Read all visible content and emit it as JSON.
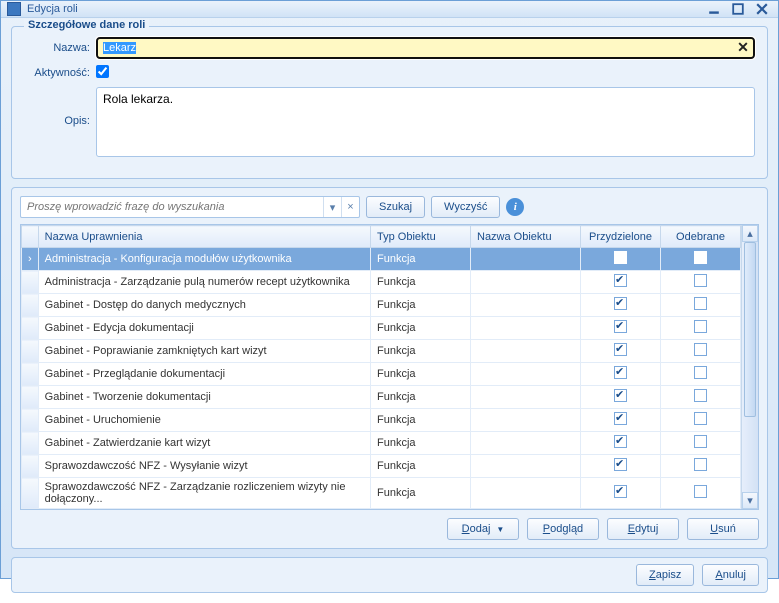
{
  "window": {
    "title": "Edycja roli"
  },
  "details_panel": {
    "legend": "Szczegółowe dane roli",
    "name_label": "Nazwa:",
    "name_value": "Lekarz",
    "active_label": "Aktywność:",
    "active_checked": true,
    "desc_label": "Opis:",
    "desc_value": "Rola lekarza."
  },
  "search": {
    "placeholder": "Proszę wprowadzić frazę do wyszukania",
    "search_btn": "Szukaj",
    "clear_btn": "Wyczyść"
  },
  "grid": {
    "headers": {
      "name": "Nazwa Uprawnienia",
      "type": "Typ Obiektu",
      "objname": "Nazwa Obiektu",
      "assigned": "Przydzielone",
      "revoked": "Odebrane"
    },
    "rows": [
      {
        "name": "Administracja - Konfiguracja modułów użytkownika",
        "type": "Funkcja",
        "objname": "",
        "assigned": true,
        "revoked_filled": true,
        "selected": true
      },
      {
        "name": "Administracja - Zarządzanie pulą numerów recept użytkownika",
        "type": "Funkcja",
        "objname": "",
        "assigned": true,
        "revoked": false
      },
      {
        "name": "Gabinet - Dostęp do danych medycznych",
        "type": "Funkcja",
        "objname": "",
        "assigned": true,
        "revoked": false
      },
      {
        "name": "Gabinet - Edycja dokumentacji",
        "type": "Funkcja",
        "objname": "",
        "assigned": true,
        "revoked": false
      },
      {
        "name": "Gabinet - Poprawianie zamkniętych kart wizyt",
        "type": "Funkcja",
        "objname": "",
        "assigned": true,
        "revoked": false
      },
      {
        "name": "Gabinet - Przeglądanie dokumentacji",
        "type": "Funkcja",
        "objname": "",
        "assigned": true,
        "revoked": false
      },
      {
        "name": "Gabinet - Tworzenie dokumentacji",
        "type": "Funkcja",
        "objname": "",
        "assigned": true,
        "revoked": false
      },
      {
        "name": "Gabinet - Uruchomienie",
        "type": "Funkcja",
        "objname": "",
        "assigned": true,
        "revoked": false
      },
      {
        "name": "Gabinet - Zatwierdzanie kart wizyt",
        "type": "Funkcja",
        "objname": "",
        "assigned": true,
        "revoked": false
      },
      {
        "name": "Sprawozdawczość NFZ - Wysyłanie wizyt",
        "type": "Funkcja",
        "objname": "",
        "assigned": true,
        "revoked": false
      },
      {
        "name": "Sprawozdawczość NFZ - Zarządzanie rozliczeniem wizyty nie dołączony...",
        "type": "Funkcja",
        "objname": "",
        "assigned": true,
        "revoked": false
      }
    ]
  },
  "actions": {
    "add": "Dodaj",
    "preview": "Podgląd",
    "edit": "Edytuj",
    "delete": "Usuń"
  },
  "bottom": {
    "save": "Zapisz",
    "cancel": "Anuluj"
  }
}
